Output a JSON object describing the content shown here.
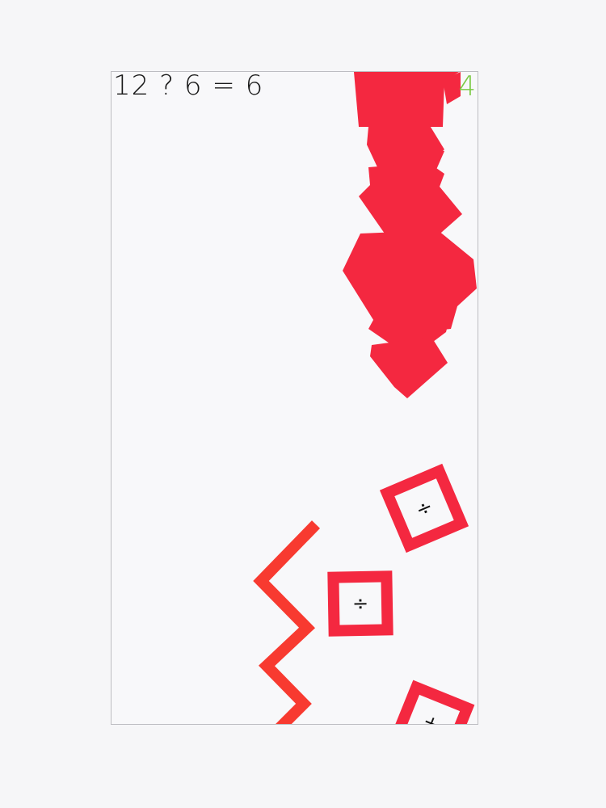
{
  "hud": {
    "equation": "12 ? 6 = 6",
    "score": "4",
    "score_color": "#7ac943"
  },
  "colors": {
    "block": "#f42840",
    "zigzag": "#f83a30",
    "frame": "#bdbdc2"
  },
  "operator_blocks": [
    {
      "symbol": "÷",
      "icon": "divide-icon"
    },
    {
      "symbol": "÷",
      "icon": "divide-icon"
    },
    {
      "symbol": "+",
      "icon": "plus-icon"
    }
  ]
}
